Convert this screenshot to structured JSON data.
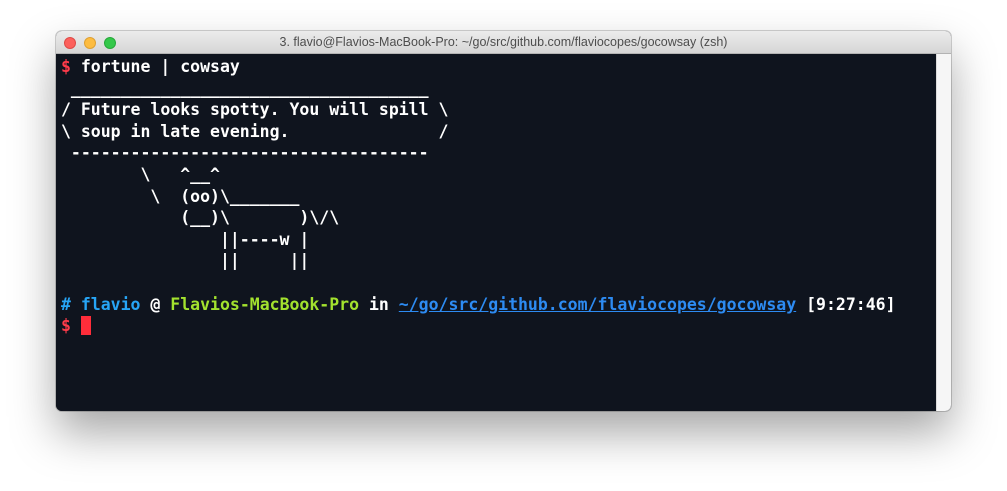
{
  "window": {
    "title": "3. flavio@Flavios-MacBook-Pro: ~/go/src/github.com/flaviocopes/gocowsay (zsh)"
  },
  "terminal": {
    "prompt_symbol": "$",
    "command": "fortune | cowsay",
    "output": [
      " ____________________________________",
      "/ Future looks spotty. You will spill \\",
      "\\ soup in late evening.               /",
      " ------------------------------------",
      "        \\   ^__^",
      "         \\  (oo)\\_______",
      "            (__)\\       )\\/\\",
      "                ||----w |",
      "                ||     ||",
      ""
    ],
    "status": {
      "hash": "#",
      "user": "flavio",
      "at": "@",
      "host": "Flavios-MacBook-Pro",
      "in": "in",
      "path": "~/go/src/github.com/flaviocopes/gocowsay",
      "time": "[9:27:46]"
    },
    "second_prompt_symbol": "$"
  }
}
